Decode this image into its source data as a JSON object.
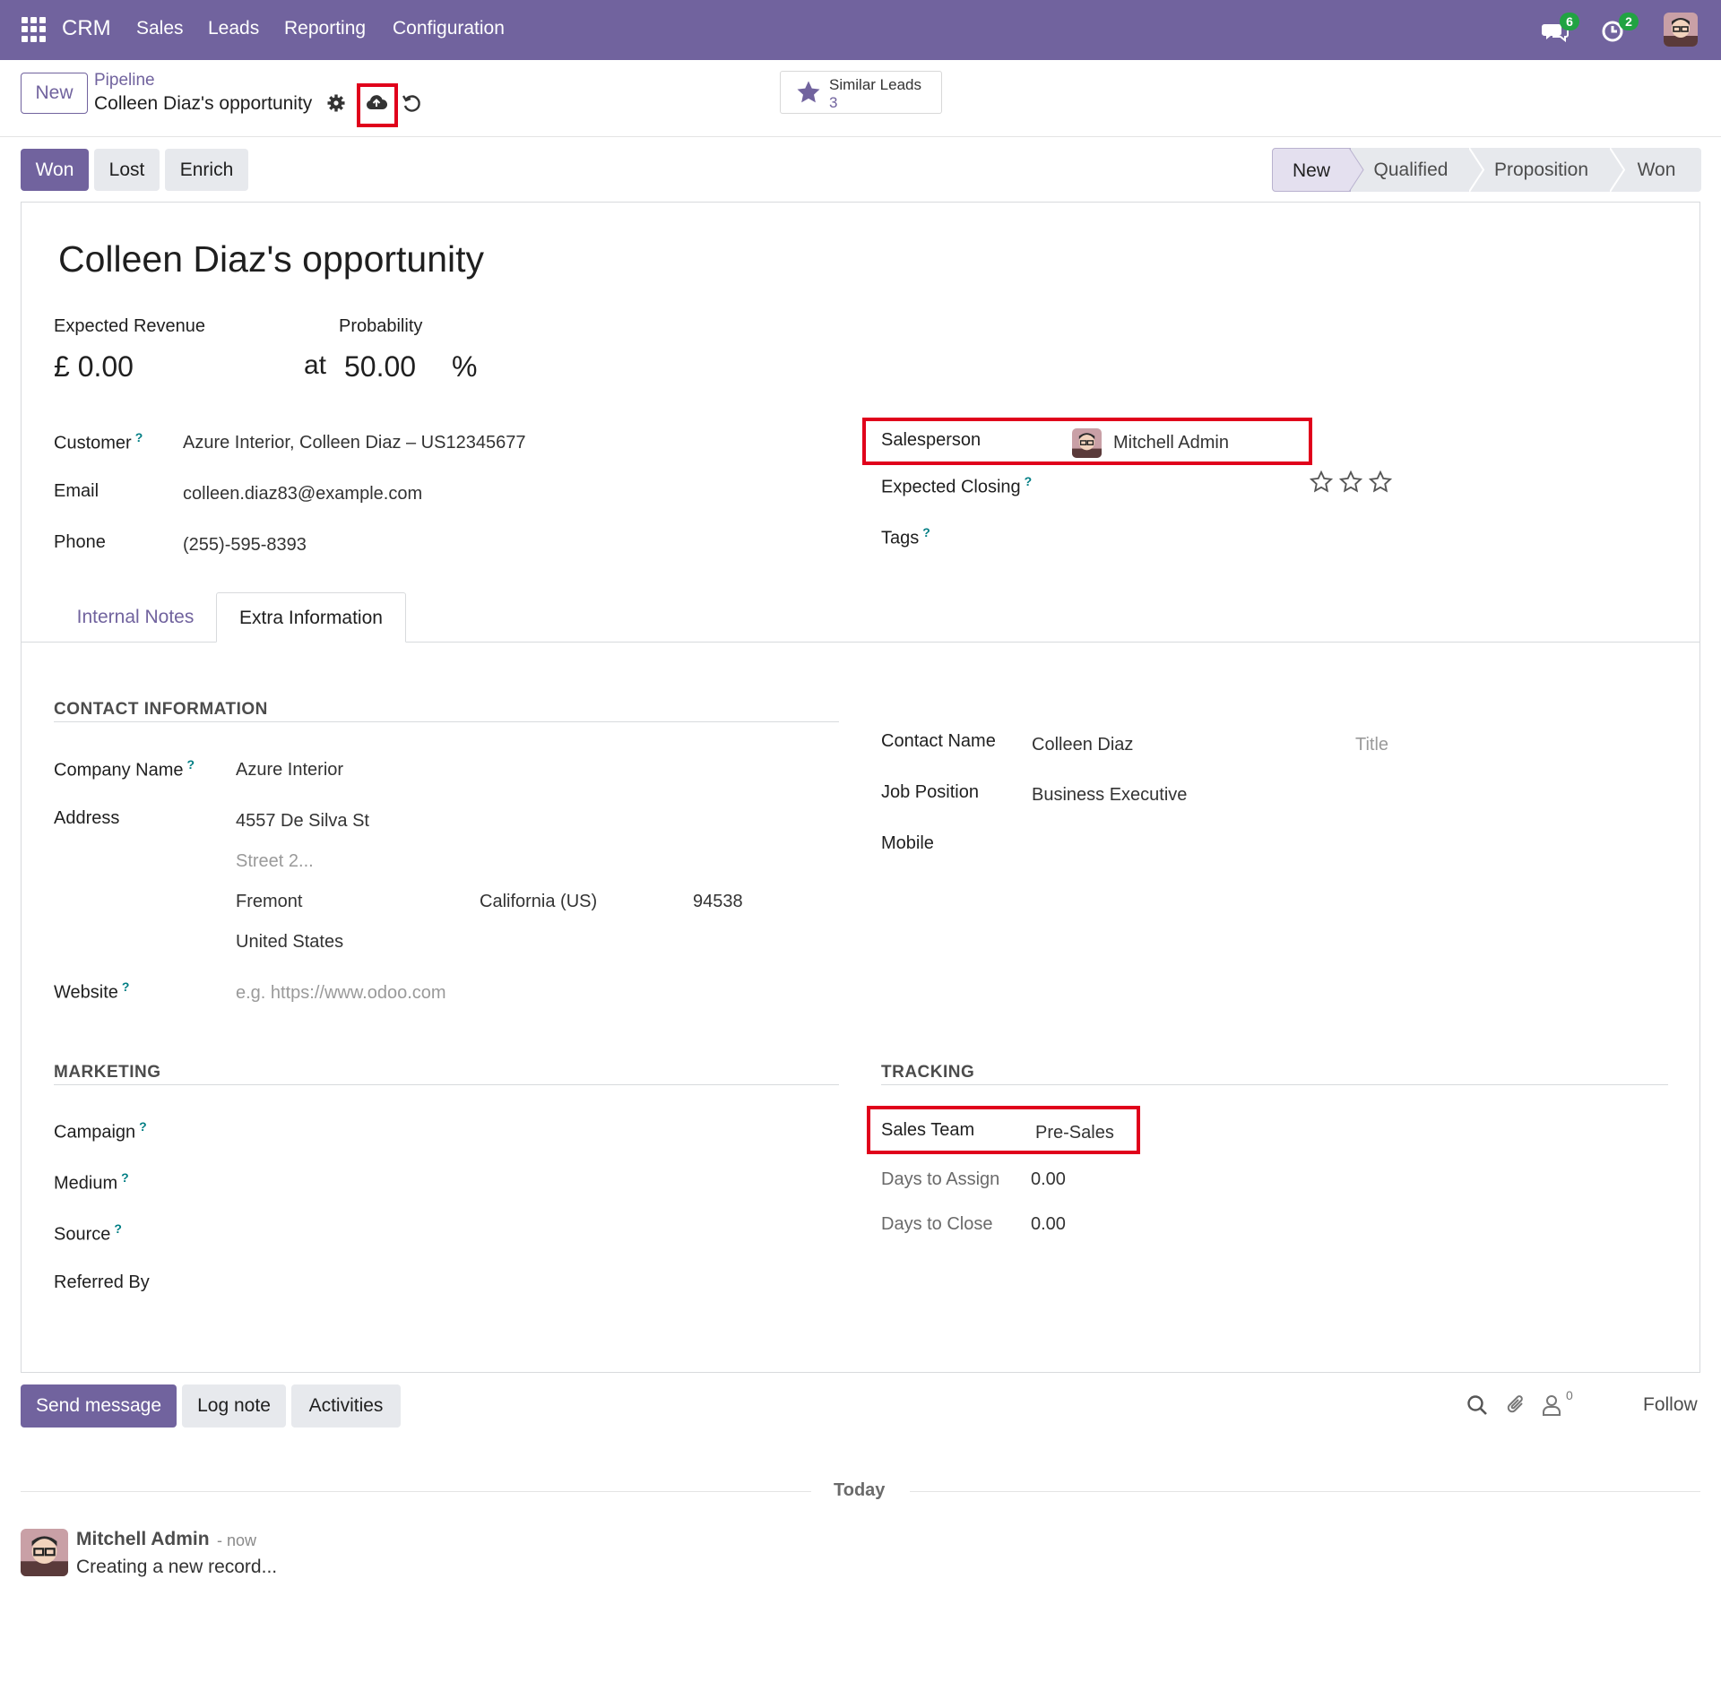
{
  "navbar": {
    "brand": "CRM",
    "menu": [
      "Sales",
      "Leads",
      "Reporting",
      "Configuration"
    ],
    "messages_count": "6",
    "activities_count": "2"
  },
  "control_panel": {
    "new_label": "New",
    "breadcrumb": "Pipeline",
    "record_title": "Colleen Diaz's opportunity",
    "similar_leads_label": "Similar Leads",
    "similar_leads_count": "3"
  },
  "actions": {
    "won": "Won",
    "lost": "Lost",
    "enrich": "Enrich"
  },
  "stages": {
    "items": [
      "New",
      "Qualified",
      "Proposition",
      "Won"
    ],
    "active": "New"
  },
  "form": {
    "title": "Colleen Diaz's opportunity",
    "expected_revenue_label": "Expected Revenue",
    "expected_revenue_value": "£ 0.00",
    "probability_label": "Probability",
    "at_label": "at",
    "probability_value": "50.00",
    "percent_sign": "%",
    "customer_label": "Customer",
    "customer_value": "Azure Interior, Colleen Diaz – US12345677",
    "email_label": "Email",
    "email_value": "colleen.diaz83@example.com",
    "phone_label": "Phone",
    "phone_value": "(255)-595-8393",
    "salesperson_label": "Salesperson",
    "salesperson_value": "Mitchell Admin",
    "expected_closing_label": "Expected Closing",
    "tags_label": "Tags",
    "priority_stars": 0,
    "help_mark": "?"
  },
  "tabs": {
    "internal_notes": "Internal Notes",
    "extra_information": "Extra Information",
    "active": "Extra Information"
  },
  "contact_info": {
    "heading": "CONTACT INFORMATION",
    "company_name_label": "Company Name",
    "company_name_value": "Azure Interior",
    "address_label": "Address",
    "street": "4557 De Silva St",
    "street2_placeholder": "Street 2...",
    "city": "Fremont",
    "state": "California (US)",
    "zip": "94538",
    "country": "United States",
    "website_label": "Website",
    "website_placeholder": "e.g. https://www.odoo.com",
    "contact_name_label": "Contact Name",
    "contact_name_value": "Colleen Diaz",
    "title_placeholder": "Title",
    "job_position_label": "Job Position",
    "job_position_value": "Business Executive",
    "mobile_label": "Mobile"
  },
  "marketing": {
    "heading": "MARKETING",
    "campaign_label": "Campaign",
    "medium_label": "Medium",
    "source_label": "Source",
    "referred_by_label": "Referred By"
  },
  "tracking": {
    "heading": "TRACKING",
    "sales_team_label": "Sales Team",
    "sales_team_value": "Pre-Sales",
    "days_to_assign_label": "Days to Assign",
    "days_to_assign_value": "0.00",
    "days_to_close_label": "Days to Close",
    "days_to_close_value": "0.00"
  },
  "chatter": {
    "send_message": "Send message",
    "log_note": "Log note",
    "activities": "Activities",
    "followers_count": "0",
    "follow": "Follow",
    "date_separator": "Today",
    "message_author": "Mitchell Admin",
    "message_time": "- now",
    "message_body": "Creating a new record..."
  },
  "colors": {
    "brand": "#71639e",
    "highlight": "#e0001b",
    "badge": "#21a342",
    "help": "#017e84"
  }
}
